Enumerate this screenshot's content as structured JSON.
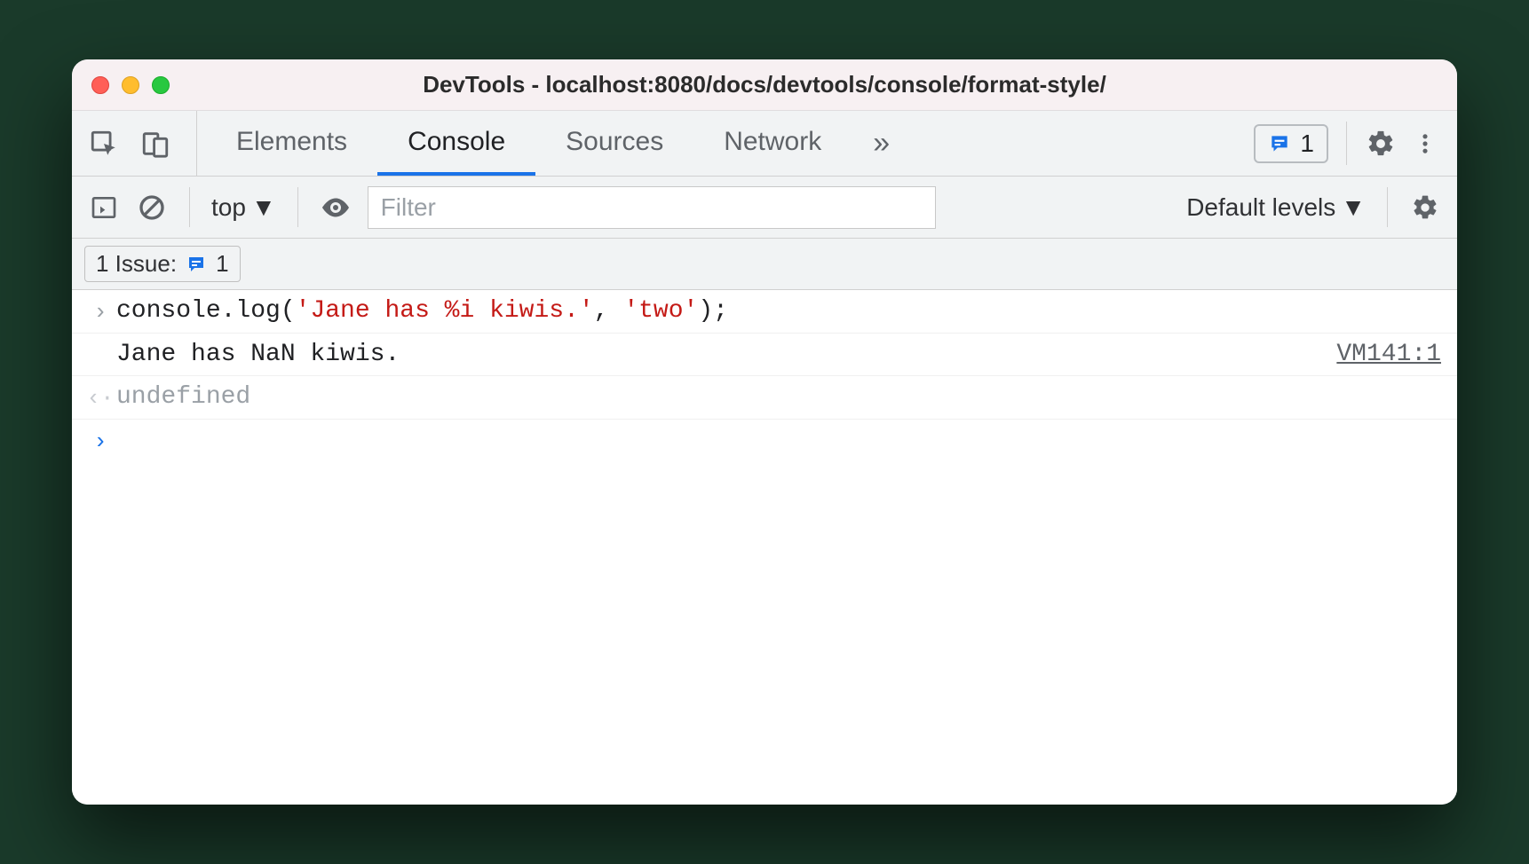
{
  "window": {
    "title": "DevTools - localhost:8080/docs/devtools/console/format-style/"
  },
  "tabs": {
    "items": [
      "Elements",
      "Console",
      "Sources",
      "Network"
    ],
    "active_index": 1,
    "overflow_glyph": "»"
  },
  "toolbar": {
    "issues_count": "1"
  },
  "filter": {
    "context_label": "top",
    "placeholder": "Filter",
    "levels_label": "Default levels"
  },
  "issues": {
    "chip_label": "1 Issue:",
    "chip_count": "1"
  },
  "console": {
    "input_line": {
      "pre": "console.log(",
      "str1": "'Jane has %i kiwis.'",
      "mid": ", ",
      "str2": "'two'",
      "post": ");"
    },
    "output_line": "Jane has NaN kiwis.",
    "output_source": "VM141:1",
    "return_line": "undefined"
  }
}
